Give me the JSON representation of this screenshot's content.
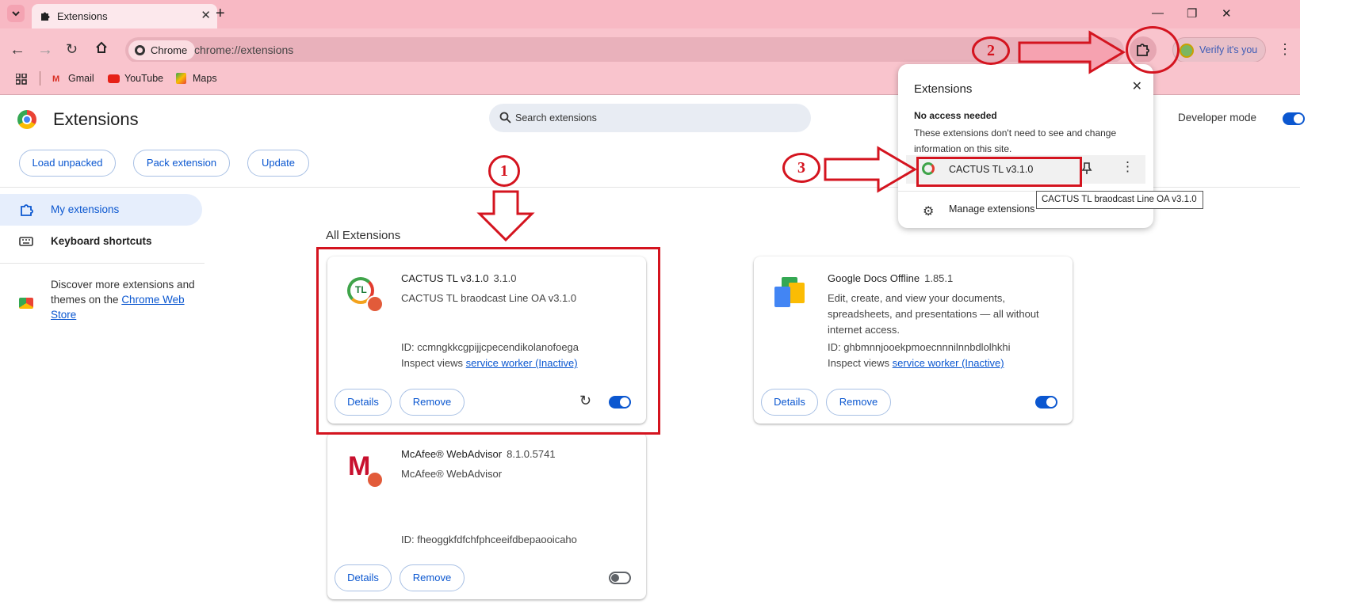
{
  "tabs": [
    {
      "title": "Extensions"
    }
  ],
  "address_bar": {
    "chip": "Chrome",
    "url": "chrome://extensions"
  },
  "bookmarks": [
    {
      "label": "Gmail"
    },
    {
      "label": "YouTube"
    },
    {
      "label": "Maps"
    }
  ],
  "profile_button": {
    "label": "Verify it's you"
  },
  "page": {
    "title": "Extensions",
    "search_placeholder": "Search extensions",
    "developer_mode_label": "Developer mode",
    "developer_mode_on": true,
    "toolbar_buttons": [
      "Load unpacked",
      "Pack extension",
      "Update"
    ]
  },
  "sidebar": {
    "items": [
      {
        "label": "My extensions",
        "icon": "puzzle-icon",
        "active": true
      },
      {
        "label": "Keyboard shortcuts",
        "icon": "keyboard-icon",
        "active": false
      }
    ],
    "discover_text": "Discover more extensions and themes on the ",
    "discover_link": "Chrome Web Store"
  },
  "section_title": "All Extensions",
  "extensions": [
    {
      "name": "CACTUS TL v3.1.0",
      "version": "3.1.0",
      "description": "CACTUS TL braodcast Line OA v3.1.0",
      "id": "ID: ccmngkkcgpijjcpecendikolanofoega",
      "inspect_label": "Inspect views",
      "inspect_link": "service worker (Inactive)",
      "details_label": "Details",
      "remove_label": "Remove",
      "enabled": true,
      "has_reload": true
    },
    {
      "name": "Google Docs Offline",
      "version": "1.85.1",
      "description": "Edit, create, and view your documents, spreadsheets, and presentations — all without internet access.",
      "id": "ID: ghbmnnjooekpmoecnnnilnnbdlolhkhi",
      "inspect_label": "Inspect views",
      "inspect_link": "service worker (Inactive)",
      "details_label": "Details",
      "remove_label": "Remove",
      "enabled": true,
      "has_reload": false
    },
    {
      "name": "McAfee® WebAdvisor",
      "version": "8.1.0.5741",
      "description": "McAfee® WebAdvisor",
      "id": "ID: fheoggkfdfchfphceeifdbepaooicaho",
      "details_label": "Details",
      "remove_label": "Remove",
      "enabled": false,
      "has_reload": false
    }
  ],
  "extensions_popup": {
    "title": "Extensions",
    "section": "No access needed",
    "text": "These extensions don't need to see and change information on this site.",
    "item_label": "CACTUS TL v3.1.0",
    "manage_label": "Manage extensions",
    "tooltip": "CACTUS TL braodcast Line OA v3.1.0"
  },
  "annotations": [
    "1",
    "2",
    "3"
  ],
  "colors": {
    "accent": "#0b57d0",
    "annotation": "#d4141f",
    "titlebar": "#f8b9c4"
  }
}
